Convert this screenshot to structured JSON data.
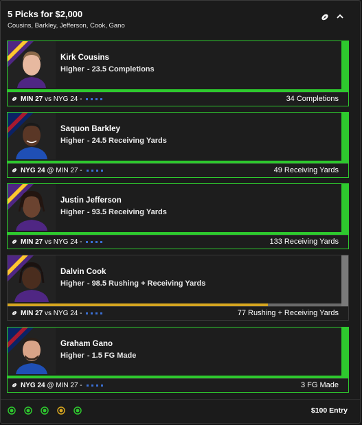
{
  "header": {
    "title": "5 Picks for $2,000",
    "subtitle": "Cousins, Barkley, Jefferson, Cook, Gano",
    "icons": [
      "football-icon",
      "chevron-up-icon"
    ]
  },
  "colors": {
    "win_green": "#2ec92e",
    "pending_gold": "#d6a620",
    "vikings_purple": "#4f2683",
    "vikings_gold": "#ffc62f",
    "giants_blue": "#0b2265",
    "giants_red": "#a71930",
    "dot_blue": "#3b6fd4"
  },
  "picks": [
    {
      "name": "Kirk Cousins",
      "direction": "Higher",
      "line": "- 23.5 Completions",
      "game_team1": "MIN 27",
      "game_vs": "vs NYG 24 -",
      "result": "34 Completions",
      "status": "win",
      "team": "vikings",
      "icon": "football-icon"
    },
    {
      "name": "Saquon Barkley",
      "direction": "Higher",
      "line": "- 24.5 Receiving Yards",
      "game_team1": "NYG 24",
      "game_vs": "@ MIN 27 -",
      "result": "49 Receiving Yards",
      "status": "win",
      "team": "giants",
      "icon": "football-icon"
    },
    {
      "name": "Justin Jefferson",
      "direction": "Higher",
      "line": "- 93.5 Receiving Yards",
      "game_team1": "MIN 27",
      "game_vs": "vs NYG 24 -",
      "result": "133 Receiving Yards",
      "status": "win",
      "team": "vikings",
      "icon": "football-icon"
    },
    {
      "name": "Dalvin Cook",
      "direction": "Higher",
      "line": "- 98.5 Rushing + Receiving Yards",
      "game_team1": "MIN 27",
      "game_vs": "vs NYG 24 -",
      "result": "77 Rushing + Receiving Yards",
      "status": "loss",
      "progress_fraction": 0.78,
      "team": "vikings",
      "icon": "football-icon"
    },
    {
      "name": "Graham Gano",
      "direction": "Higher",
      "line": "- 1.5 FG Made",
      "game_team1": "NYG 24",
      "game_vs": "@ MIN 27 -",
      "result": "3 FG Made",
      "status": "win",
      "team": "giants",
      "icon": "football-icon"
    }
  ],
  "footer": {
    "status_dots": [
      "green",
      "green",
      "green",
      "gold",
      "green"
    ],
    "entry": "$100 Entry"
  }
}
